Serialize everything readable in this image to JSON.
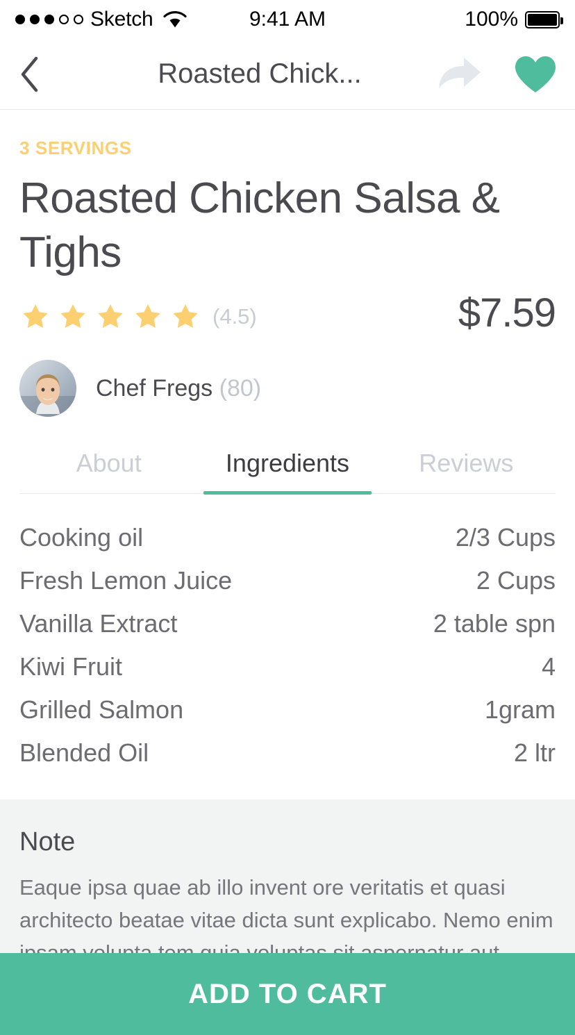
{
  "status_bar": {
    "signal_dots_filled": 3,
    "signal_dots_total": 5,
    "carrier": "Sketch",
    "wifi_icon": "wifi-icon",
    "time": "9:41 AM",
    "battery_percent": "100%",
    "battery_icon": "battery-full-icon"
  },
  "navbar": {
    "back_icon": "chevron-left-icon",
    "title": "Roasted Chick...",
    "share_icon": "share-arrow-icon",
    "favorite_icon": "heart-filled-icon"
  },
  "recipe": {
    "servings": "3 SERVINGS",
    "title": "Roasted Chicken Salsa & Tighs",
    "rating_stars": 5,
    "rating_value": "(4.5)",
    "price": "$7.59",
    "chef_name": "Chef Fregs",
    "chef_count": "(80)",
    "avatar_icon": "chef-avatar"
  },
  "tabs": [
    {
      "label": "About",
      "active": false
    },
    {
      "label": "Ingredients",
      "active": true
    },
    {
      "label": "Reviews",
      "active": false
    }
  ],
  "ingredients": [
    {
      "name": "Cooking oil",
      "amount": "2/3 Cups"
    },
    {
      "name": "Fresh Lemon Juice",
      "amount": "2 Cups"
    },
    {
      "name": "Vanilla Extract",
      "amount": "2 table spn"
    },
    {
      "name": "Kiwi Fruit",
      "amount": "4"
    },
    {
      "name": "Grilled Salmon",
      "amount": "1gram"
    },
    {
      "name": "Blended Oil",
      "amount": "2 ltr"
    }
  ],
  "note": {
    "title": "Note",
    "body": "Eaque ipsa quae ab illo invent ore veritatis et quasi architecto beatae vitae dicta sunt explicabo. Nemo enim ipsam volupta tem quia voluptas sit aspernatur aut oditautew explicabo."
  },
  "cta": {
    "label": "ADD TO CART"
  },
  "colors": {
    "accent_green": "#4fbc9e",
    "servings_yellow": "#fcd070",
    "star_gold": "#fcd070",
    "text_dark": "#4a4a4f",
    "text_muted": "#c3c6cc",
    "note_bg": "#f2f3f3"
  }
}
